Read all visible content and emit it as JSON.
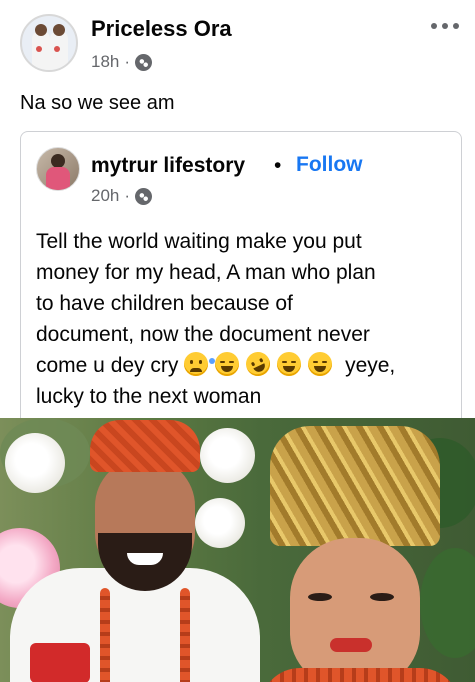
{
  "post": {
    "author": "Priceless Ora",
    "time": "18h",
    "separator": "·",
    "text": "Na so we see am"
  },
  "shared": {
    "author": "mytrur lifestory",
    "dot": "•",
    "follow_label": "Follow",
    "time": "20h",
    "separator": "·",
    "lines": [
      "Tell the world waiting make you put",
      "money for my head, A man who plan",
      "to have children because of",
      "document, now the document never"
    ],
    "line5_text": "come u dey cry",
    "line5_suffix": "yeye,",
    "line6": "lucky to the next woman"
  },
  "icons": {
    "audience": "globe-icon",
    "menu": "more-options-icon",
    "emojis": [
      "crying-face",
      "grinning-squinting-face",
      "rolling-on-floor-laughing-face",
      "face-with-tears-of-joy",
      "grinning-squinting-face"
    ]
  },
  "colors": {
    "follow": "#1877f2",
    "meta": "#65676b",
    "text": "#050505",
    "border": "#ced0d4"
  }
}
